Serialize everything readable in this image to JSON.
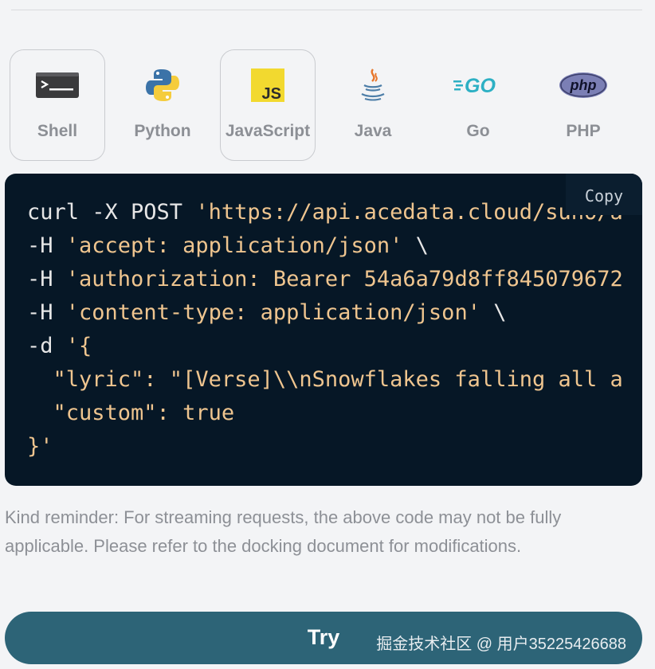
{
  "tabs": [
    {
      "id": "shell",
      "label": "Shell",
      "icon": "terminal-icon"
    },
    {
      "id": "python",
      "label": "Python",
      "icon": "python-logo-icon"
    },
    {
      "id": "javascript",
      "label": "JavaScript",
      "icon": "js-logo-icon"
    },
    {
      "id": "java",
      "label": "Java",
      "icon": "java-logo-icon"
    },
    {
      "id": "go",
      "label": "Go",
      "icon": "go-logo-icon"
    },
    {
      "id": "php",
      "label": "PHP",
      "icon": "php-logo-icon"
    }
  ],
  "code": {
    "copy_label": "Copy",
    "lines": [
      [
        {
          "t": "curl -X POST ",
          "c": "plain"
        },
        {
          "t": "'https://api.acedata.cloud/suno/a",
          "c": "str"
        }
      ],
      [
        {
          "t": "-H ",
          "c": "plain"
        },
        {
          "t": "'accept: application/json'",
          "c": "str"
        },
        {
          "t": " \\",
          "c": "plain"
        }
      ],
      [
        {
          "t": "-H ",
          "c": "plain"
        },
        {
          "t": "'authorization: Bearer 54a6a79d8ff845079672",
          "c": "str"
        }
      ],
      [
        {
          "t": "-H ",
          "c": "plain"
        },
        {
          "t": "'content-type: application/json'",
          "c": "str"
        },
        {
          "t": " \\",
          "c": "plain"
        }
      ],
      [
        {
          "t": "-d ",
          "c": "plain"
        },
        {
          "t": "'{",
          "c": "str"
        }
      ],
      [
        {
          "t": "  \"lyric\": \"[Verse]\\\\nSnowflakes falling all a",
          "c": "str"
        }
      ],
      [
        {
          "t": "  \"custom\": true",
          "c": "str"
        }
      ],
      [
        {
          "t": "}'",
          "c": "str"
        }
      ]
    ]
  },
  "reminder": "Kind reminder: For streaming requests, the above code may not be fully applicable. Please refer to the docking document for modifications.",
  "try_button": {
    "label": "Try"
  },
  "watermark": "掘金技术社区 @ 用户35225426688",
  "colors": {
    "code_bg": "#061726",
    "string": "#efc58f",
    "try_bg": "#2d6477"
  }
}
